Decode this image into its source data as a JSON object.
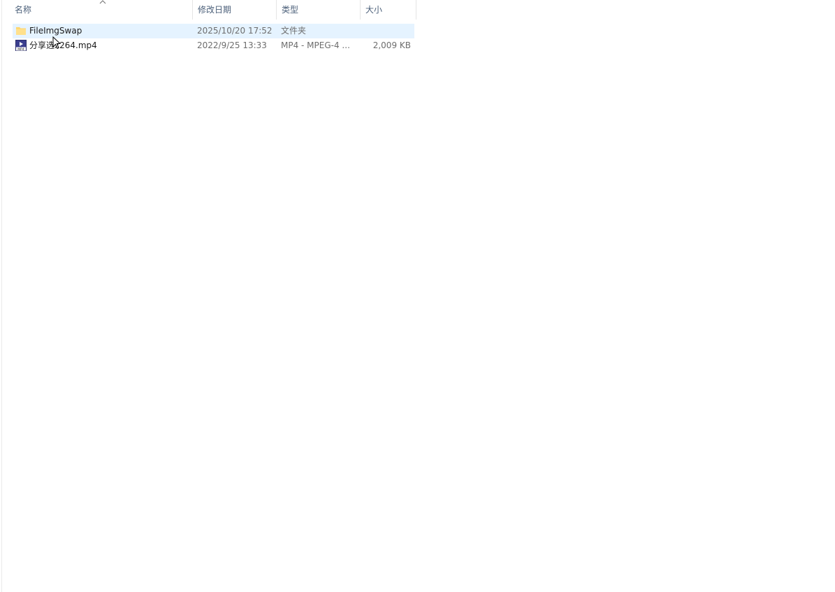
{
  "columns": {
    "name": "名称",
    "date": "修改日期",
    "type": "类型",
    "size": "大小"
  },
  "sort": {
    "column": "name",
    "direction": "ascending",
    "icon": "chevron-up-icon"
  },
  "files": [
    {
      "name": "FileImgSwap",
      "date": "2025/10/20 17:52",
      "type": "文件夹",
      "size": "",
      "icon": "folder-icon",
      "selected": true
    },
    {
      "name": "分享选x264.mp4",
      "date": "2022/9/25 13:33",
      "type": "MP4 - MPEG-4 ...",
      "size": "2,009 KB",
      "icon": "mp4-file-icon",
      "selected": false
    }
  ],
  "colors": {
    "selection": "#e5f3ff",
    "header_text": "#4c607a",
    "folder": "#ffd56a"
  }
}
